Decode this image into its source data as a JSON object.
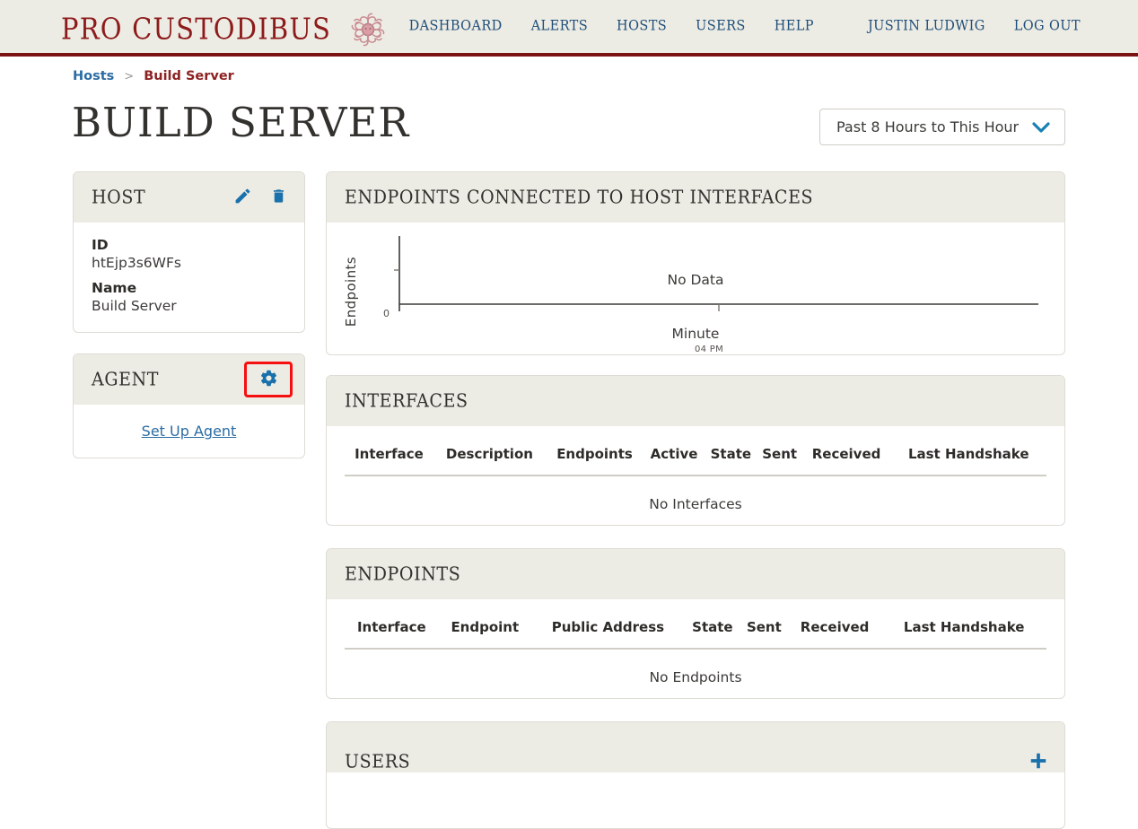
{
  "header": {
    "brand": "PRO CUSTODIBUS",
    "emblem_icon": "medusa-emblem-icon",
    "brand_color": "#8d1b1b",
    "nav": [
      {
        "label": "DASHBOARD"
      },
      {
        "label": "ALERTS"
      },
      {
        "label": "HOSTS"
      },
      {
        "label": "USERS"
      },
      {
        "label": "HELP"
      }
    ],
    "user_nav": [
      {
        "label": "JUSTIN LUDWIG"
      },
      {
        "label": "LOG OUT"
      }
    ]
  },
  "breadcrumb": {
    "parent": "Hosts",
    "separator": ">",
    "current": "Build Server"
  },
  "page": {
    "title": "BUILD SERVER"
  },
  "range_select": {
    "value": "Past 8 Hours to This Hour",
    "chevron_icon": "chevron-down-icon",
    "accent": "#1a7fb5"
  },
  "host_panel": {
    "title": "HOST",
    "edit_icon": "pencil-icon",
    "delete_icon": "trash-icon",
    "fields": [
      {
        "label": "ID",
        "value": "htEjp3s6WFs"
      },
      {
        "label": "Name",
        "value": "Build Server"
      }
    ]
  },
  "agent_panel": {
    "title": "AGENT",
    "settings_icon": "gear-icon",
    "settings_highlight_color": "#f60f0f",
    "setup_link": "Set Up Agent"
  },
  "chart_panel": {
    "title": "ENDPOINTS CONNECTED TO HOST INTERFACES"
  },
  "chart_data": {
    "type": "line",
    "title": "Endpoints Connected to Host Interfaces",
    "xlabel": "Minute",
    "ylabel": "Endpoints",
    "x": [],
    "values": [],
    "series": [],
    "xtick_labels": [
      "04 PM"
    ],
    "ytick_labels": [
      "0"
    ],
    "ylim": [
      0,
      1
    ],
    "grid": false,
    "legend": false,
    "empty_message": "No Data"
  },
  "interfaces_panel": {
    "title": "INTERFACES",
    "columns": [
      "Interface",
      "Description",
      "Endpoints",
      "Active",
      "State",
      "Sent",
      "Received",
      "Last Handshake"
    ],
    "rows": [],
    "empty_message": "No Interfaces"
  },
  "endpoints_panel": {
    "title": "ENDPOINTS",
    "columns": [
      "Interface",
      "Endpoint",
      "Public Address",
      "State",
      "Sent",
      "Received",
      "Last Handshake"
    ],
    "rows": [],
    "empty_message": "No Endpoints"
  },
  "users_panel": {
    "title": "USERS",
    "add_icon": "plus-icon"
  }
}
